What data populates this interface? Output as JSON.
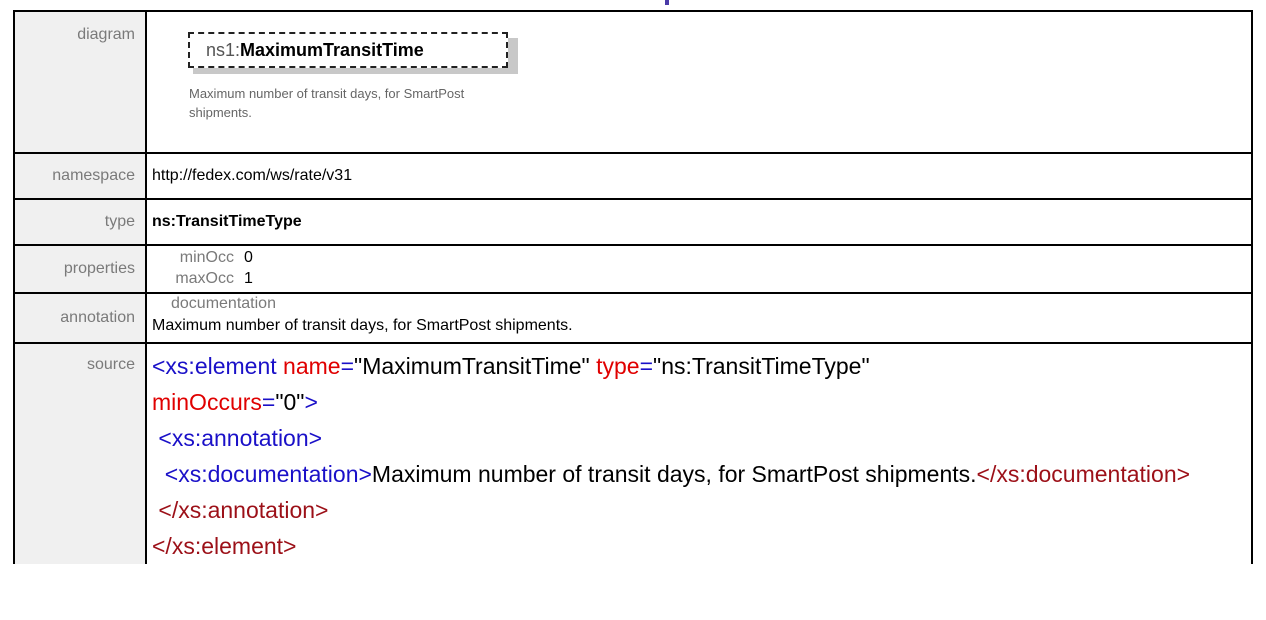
{
  "rows": {
    "diagram": {
      "label": "diagram",
      "prefix": "ns1:",
      "name": "MaximumTransitTime",
      "doc": "Maximum number of transit days, for SmartPost shipments."
    },
    "namespace": {
      "label": "namespace",
      "value": "http://fedex.com/ws/rate/v31"
    },
    "type": {
      "label": "type",
      "value": "ns:TransitTimeType"
    },
    "properties": {
      "label": "properties",
      "items": [
        {
          "name": "minOcc",
          "value": "0"
        },
        {
          "name": "maxOcc",
          "value": "1"
        }
      ]
    },
    "annotation": {
      "label": "annotation",
      "heading": "documentation",
      "text": "Maximum number of transit days, for SmartPost shipments."
    },
    "source": {
      "label": "source",
      "tokens": {
        "t1": "<xs:element",
        "a1": "name",
        "eq1": "=",
        "v1": "\"MaximumTransitTime\"",
        "a2": "type",
        "eq2": "=",
        "v2": "\"ns:TransitTimeType\"",
        "a3": "minOccurs",
        "eq3": "=",
        "v3": "\"0\"",
        "gt1": ">",
        "t2": "<xs:annotation>",
        "t3": "<xs:documentation>",
        "txt": "Maximum number of transit days, for SmartPost shipments.",
        "c3": "</xs:documentation>",
        "c2": "</xs:annotation>",
        "c1": "</xs:element>"
      }
    }
  },
  "colors": {
    "tag": "#1a10c8",
    "attribute": "#e00000",
    "closing_tag": "#9c1018",
    "label_text": "#7a7a7a",
    "label_background": "#f0f0f0"
  }
}
